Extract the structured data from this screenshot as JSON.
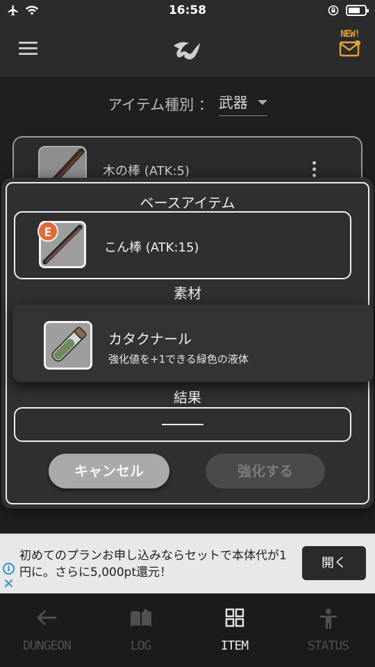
{
  "status_bar": {
    "time": "16:58"
  },
  "header": {
    "new_badge": "NEW!",
    "accent_color": "#e0a438"
  },
  "filter": {
    "label": "アイテム種別 ：",
    "selected": "武器"
  },
  "item_list": [
    {
      "name": "木の棒 (ATK:5)"
    }
  ],
  "dialog": {
    "base_title": "ベースアイテム",
    "base_item": {
      "name": "こん棒 (ATK:15)",
      "badge": "E"
    },
    "material_title": "素材",
    "material_item": {
      "name": "カタクナール",
      "description": "強化値を+1できる緑色の液体"
    },
    "result_title": "結果",
    "result_value": "———",
    "cancel_label": "キャンセル",
    "enhance_label": "強化する"
  },
  "ad": {
    "text": "初めてのプランお申し込みならセットで本体代が1円に。さらに5,000pt還元！",
    "open_label": "開く",
    "info_glyph": "i",
    "close_glyph": "✕"
  },
  "bottom_nav": {
    "tabs": [
      {
        "label": "DUNGEON",
        "icon": "arrow-left-icon",
        "active": false
      },
      {
        "label": "LOG",
        "icon": "book-icon",
        "active": false
      },
      {
        "label": "ITEM",
        "icon": "grid-icon",
        "active": true
      },
      {
        "label": "STATUS",
        "icon": "person-icon",
        "active": false
      }
    ]
  }
}
